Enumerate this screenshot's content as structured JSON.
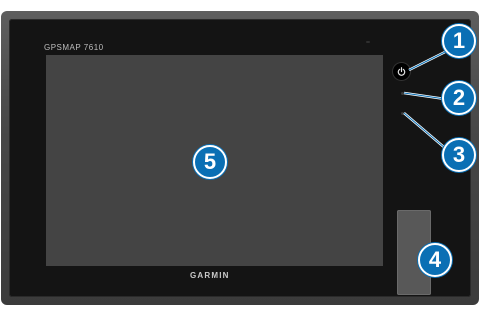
{
  "device": {
    "model_label": "GPSMAP 7610",
    "brand_label": "GARMIN",
    "power_icon": "power-icon"
  },
  "callouts": [
    "1",
    "2",
    "3",
    "4",
    "5"
  ],
  "colors": {
    "callout_fill": "#0a6fb4",
    "screen": "#444444",
    "bezel": "#141414",
    "frame": "#474747"
  }
}
